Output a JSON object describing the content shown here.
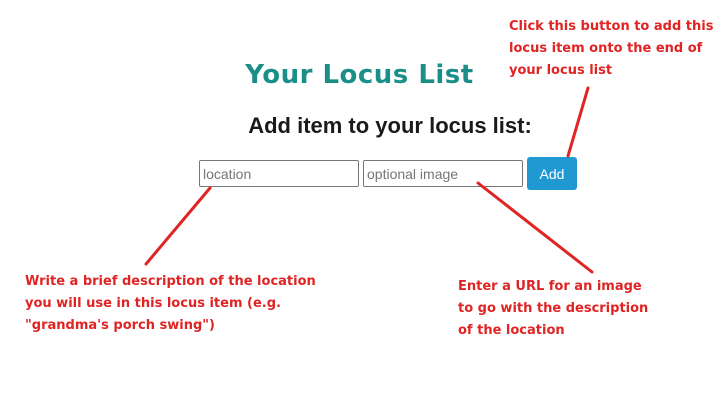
{
  "header": {
    "title": "Your Locus List",
    "subtitle": "Add item to your locus list:"
  },
  "form": {
    "location_placeholder": "location",
    "image_placeholder": "optional image",
    "add_label": "Add"
  },
  "annotations": {
    "add_button_note": "Click this button to add this locus item onto the end of your locus list",
    "location_note": "Write a brief description of the location you will use in this locus item (e.g. \"grandma's porch swing\")",
    "image_note": "Enter a URL for an image to go with the description of the location",
    "color": "#e02424"
  }
}
